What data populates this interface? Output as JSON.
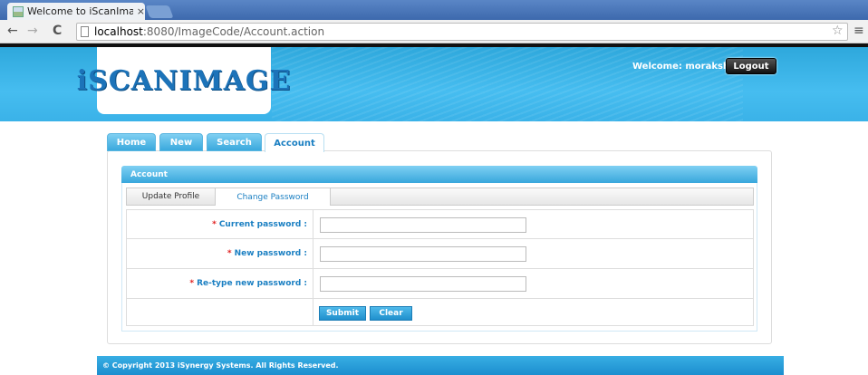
{
  "browser": {
    "tab_title": "Welcome to iScanImag",
    "tab_close": "×",
    "url_host": "localhost",
    "url_path": ":8080/ImageCode/Account.action",
    "back_glyph": "←",
    "forward_glyph": "→",
    "reload_glyph": "C",
    "star_glyph": "☆",
    "menu_glyph": "≡"
  },
  "header": {
    "logo": "iSCANIMAGE",
    "welcome": "Welcome: morakshay",
    "logout_label": "Logout"
  },
  "main_tabs": [
    {
      "label": "Home"
    },
    {
      "label": "New"
    },
    {
      "label": "Search"
    },
    {
      "label": "Account"
    }
  ],
  "panel": {
    "title": "Account",
    "subtabs": [
      {
        "label": "Update Profile"
      },
      {
        "label": "Change Password"
      }
    ]
  },
  "form": {
    "required_mark": "*",
    "rows": [
      {
        "label": "Current password :",
        "value": ""
      },
      {
        "label": "New password :",
        "value": ""
      },
      {
        "label": "Re-type new password :",
        "value": ""
      }
    ],
    "submit_label": "Submit",
    "clear_label": "Clear"
  },
  "footer": {
    "text": "© Copyright 2013 iSynergy Systems. All Rights Reserved."
  },
  "colors": {
    "accent": "#38a7dc",
    "label_blue": "#1a7fc2",
    "required": "#e02020"
  }
}
